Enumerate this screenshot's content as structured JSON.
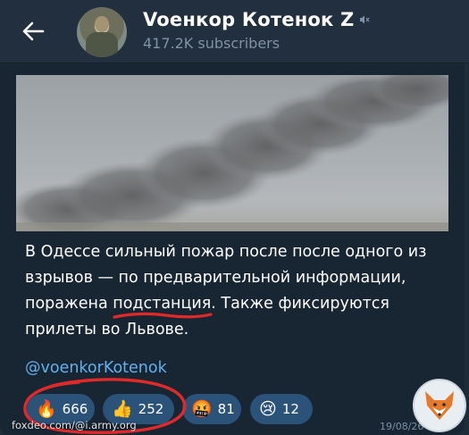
{
  "header": {
    "back_icon": "arrow-left-icon",
    "channel_title": "Voенкор Котенок Z",
    "subscribers": "417.2K subscribers",
    "mute_icon": "muted-speaker-icon"
  },
  "message": {
    "text_before": "В Одессе сильный пожар после после одного из взрывов — по предварительной информации, поражена ",
    "text_highlight": "подстанция",
    "text_after": ". Также фиксируются прилеты во Львове.",
    "channel_link": "@voenkorKotenok",
    "timestamp": "19/08/26"
  },
  "reactions": [
    {
      "emoji": "🔥",
      "count": "666",
      "icon": "fire-emoji"
    },
    {
      "emoji": "👍",
      "count": "252",
      "icon": "thumbs-up-emoji"
    },
    {
      "emoji": "🤬",
      "count": "81",
      "icon": "cursing-face-emoji"
    },
    {
      "emoji": "😢",
      "count": "12",
      "icon": "crying-face-emoji"
    }
  ],
  "watermark": "foxdeo.com/@i.army.org",
  "colors": {
    "background": "#1e2c3a",
    "bubble": "#182533",
    "reaction_bg": "#2b5278",
    "link": "#62b1ee",
    "annotation_red": "#e02a2a"
  }
}
